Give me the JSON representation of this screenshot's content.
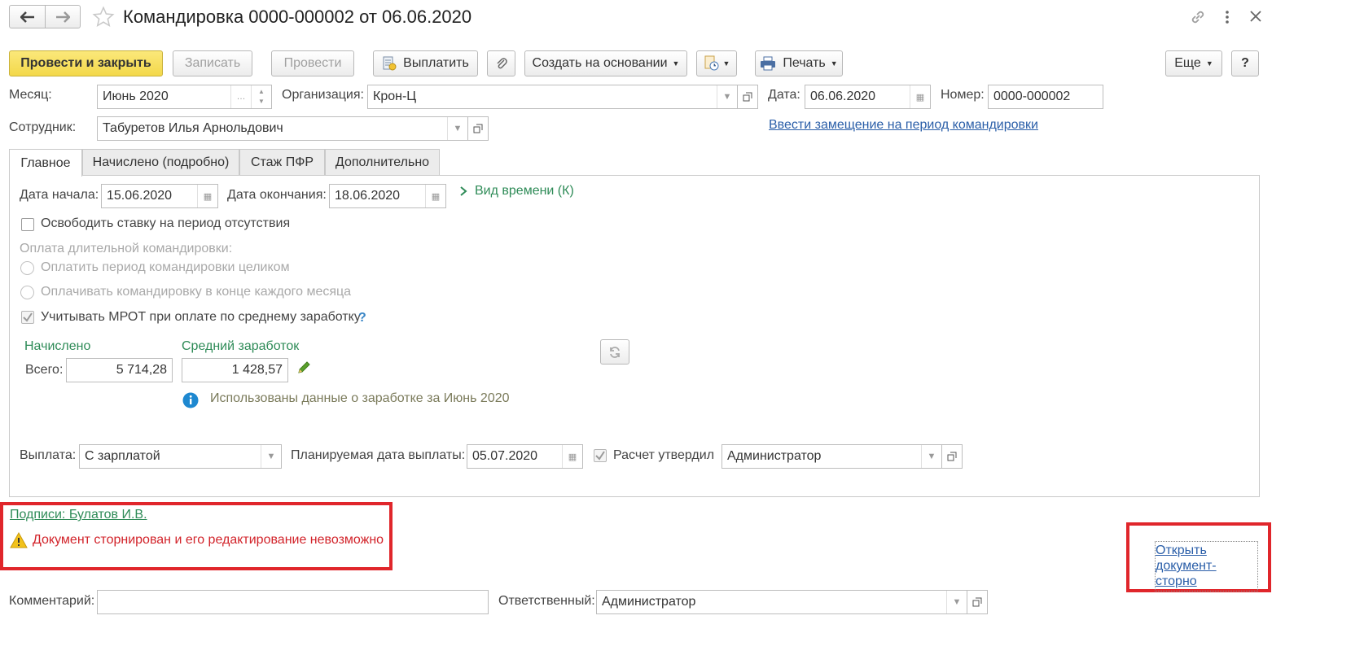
{
  "window": {
    "title": "Командировка 0000-000002 от 06.06.2020"
  },
  "toolbar": {
    "post_close": "Провести и закрыть",
    "save": "Записать",
    "post": "Провести",
    "pay": "Выплатить",
    "create_based": "Создать на основании",
    "print": "Печать",
    "more": "Еще",
    "help": "?"
  },
  "header": {
    "month_label": "Месяц:",
    "month_value": "Июнь 2020",
    "org_label": "Организация:",
    "org_value": "Крон-Ц",
    "date_label": "Дата:",
    "date_value": "06.06.2020",
    "number_label": "Номер:",
    "number_value": "0000-000002",
    "employee_label": "Сотрудник:",
    "employee_value": "Табуретов Илья Арнольдович",
    "replacement_link": "Ввести замещение на период командировки"
  },
  "tabs": [
    {
      "label": "Главное"
    },
    {
      "label": "Начислено (подробно)"
    },
    {
      "label": "Стаж ПФР"
    },
    {
      "label": "Дополнительно"
    }
  ],
  "main": {
    "start_label": "Дата начала:",
    "start_value": "15.06.2020",
    "end_label": "Дата окончания:",
    "end_value": "18.06.2020",
    "time_kind": "Вид времени (К)",
    "free_rate_label": "Освободить ставку на период отсутствия",
    "long_trip_label": "Оплата длительной командировки:",
    "pay_whole_label": "Оплатить период командировки целиком",
    "pay_monthly_label": "Оплачивать командировку в конце каждого месяца",
    "mrot_label": "Учитывать МРОТ при оплате по среднему заработку",
    "mrot_help": "?",
    "accrued_header": "Начислено",
    "avg_header": "Средний заработок",
    "total_label": "Всего:",
    "total_value": "5 714,28",
    "avg_value": "1 428,57",
    "info_text": "Использованы данные о заработке за Июнь 2020",
    "payout_label": "Выплата:",
    "payout_value": "С зарплатой",
    "planned_date_label": "Планируемая дата выплаты:",
    "planned_date_value": "05.07.2020",
    "approved_label": "Расчет утвердил",
    "approved_value": "Администратор"
  },
  "footer": {
    "signatures_link": "Подписи: Булатов И.В.",
    "warning_text": "Документ сторнирован и его редактирование невозможно",
    "open_storno_line1": "Открыть",
    "open_storno_line2": "документ-сторно",
    "comment_label": "Комментарий:",
    "comment_value": "",
    "responsible_label": "Ответственный:",
    "responsible_value": "Администратор"
  },
  "colors": {
    "primary_button": "#f3d84a",
    "link": "#2a5ea8",
    "green_text": "#2e8b57",
    "warning_text": "#d2232a",
    "highlight_box": "#e0262b",
    "info_icon": "#1e88d0"
  }
}
